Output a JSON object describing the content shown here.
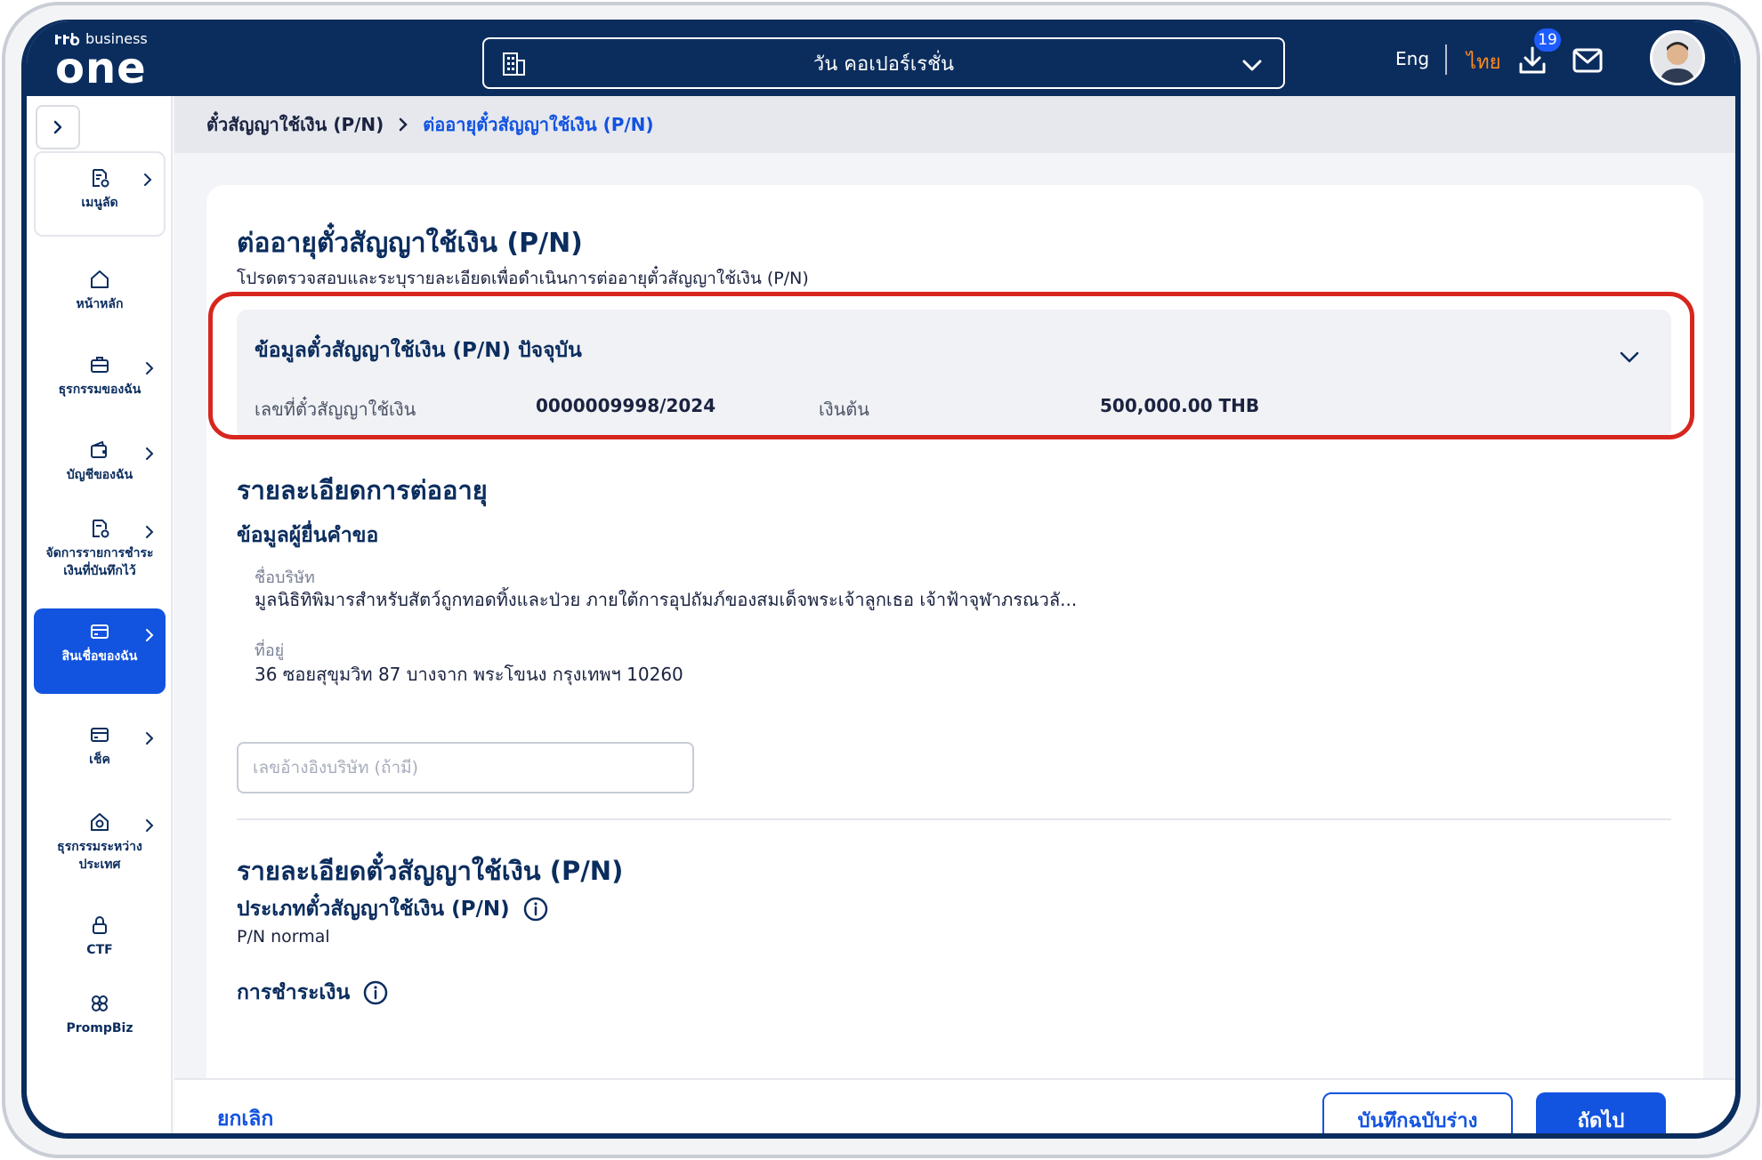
{
  "app": {
    "brand_small": "business",
    "brand_big": "one"
  },
  "header": {
    "company": "วัน คอเปอร์เรชั่น",
    "lang_en": "Eng",
    "lang_th": "ไทย",
    "download_badge": "19"
  },
  "sidebar": {
    "items": [
      {
        "label": "เมนูลัด",
        "icon": "shortcut-menu-icon"
      },
      {
        "label": "หน้าหลัก",
        "icon": "home-icon"
      },
      {
        "label": "ธุรกรรมของฉัน",
        "icon": "briefcase-icon"
      },
      {
        "label": "บัญชีของฉัน",
        "icon": "wallet-icon"
      },
      {
        "label": "จัดการรายการชำระเงินที่บันทึกไว้",
        "icon": "saved-payment-icon"
      },
      {
        "label": "สินเชื่อของฉัน",
        "icon": "credit-card-icon"
      },
      {
        "label": "เช็ค",
        "icon": "cheque-icon"
      },
      {
        "label": "ธุรกรรมระหว่างประเทศ",
        "icon": "international-icon"
      },
      {
        "label": "CTF",
        "icon": "lock-icon"
      },
      {
        "label": "PrompBiz",
        "icon": "prompbiz-icon"
      }
    ]
  },
  "breadcrumb": {
    "parent": "ตั๋วสัญญาใช้เงิน (P/N)",
    "current": "ต่ออายุตั๋วสัญญาใช้เงิน (P/N)"
  },
  "page": {
    "title": "ต่ออายุตั๋วสัญญาใช้เงิน (P/N)",
    "subtitle": "โปรดตรวจสอบและระบุรายละเอียดเพื่อดำเนินการต่ออายุตั๋วสัญญาใช้เงิน (P/N)"
  },
  "current_pn": {
    "heading": "ข้อมูลตั๋วสัญญาใช้เงิน (P/N) ปัจจุบัน",
    "number_label": "เลขที่ตั๋วสัญญาใช้เงิน",
    "number_value": "0000009998/2024",
    "principal_label": "เงินต้น",
    "principal_value": "500,000.00 THB"
  },
  "renewal": {
    "section_title": "รายละเอียดการต่ออายุ",
    "applicant_title": "ข้อมูลผู้ยื่นคำขอ",
    "company_label": "ชื่อบริษัท",
    "company_value": "มูลนิธิทิพิมารสำหรับสัตว์ถูกทอดทิ้งและป่วย ภายใต้การอุปถัมภ์ของสมเด็จพระเจ้าลูกเธอ เจ้าฟ้าจุฬาภรณวลั...",
    "address_label": "ที่อยู่",
    "address_value": "36 ซอยสุขุมวิท 87 บางจาก พระโขนง กรุงเทพฯ 10260",
    "ref_placeholder": "เลขอ้างอิงบริษัท (ถ้ามี)"
  },
  "pn_details": {
    "section_title": "รายละเอียดตั๋วสัญญาใช้เงิน (P/N)",
    "type_title": "ประเภทตั๋วสัญญาใช้เงิน (P/N)",
    "type_value": "P/N normal",
    "payment_title": "การชำระเงิน"
  },
  "footer": {
    "cancel": "ยกเลิก",
    "save_draft": "บันทึกฉบับร่าง",
    "next": "ถัดไป"
  },
  "colors": {
    "navy": "#0b2d5e",
    "primary": "#1253e0",
    "thai_accent": "#ff8a1f",
    "highlight": "#d7261e"
  }
}
